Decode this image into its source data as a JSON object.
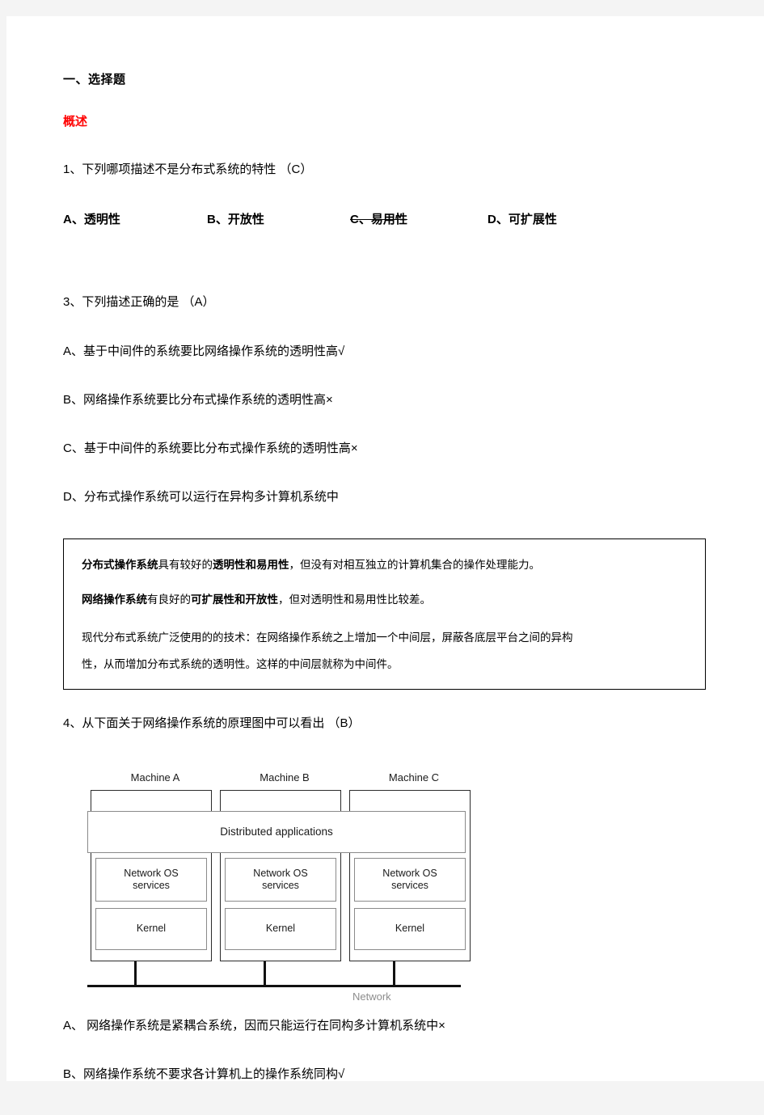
{
  "document": {
    "section_heading": "一、选择题",
    "topic_heading": "概述"
  },
  "questions": [
    {
      "prompt": "1、下列哪项描述不是分布式系统的特性  （C）",
      "options_inline": [
        {
          "label": "A、透明性",
          "struck": false
        },
        {
          "label": "B、开放性",
          "struck": false
        },
        {
          "label": "C、易用性",
          "struck": true
        },
        {
          "label": "D、可扩展性",
          "struck": false
        }
      ]
    },
    {
      "prompt": "3、下列描述正确的是  （A）",
      "options": [
        "A、基于中间件的系统要比网络操作系统的透明性高√",
        "B、网络操作系统要比分布式操作系统的透明性高×",
        "C、基于中间件的系统要比分布式操作系统的透明性高×",
        "D、分布式操作系统可以运行在异构多计算机系统中"
      ]
    },
    {
      "prompt": "4、从下面关于网络操作系统的原理图中可以看出  （B）",
      "options": [
        "A、 网络操作系统是紧耦合系统，因而只能运行在同构多计算机系统中×",
        "B、网络操作系统不要求各计算机上的操作系统同构√"
      ]
    }
  ],
  "note_box": {
    "line1_bold_1": "分布式操作系统",
    "line1_mid_1": "具有较好的",
    "line1_bold_2": "透明性和易用性",
    "line1_tail": "，但没有对相互独立的计算机集合的操作处理能力。",
    "line2_bold_1": "网络操作系统",
    "line2_mid_1": "有良好的",
    "line2_bold_2": "可扩展性和开放性",
    "line2_tail": "，但对透明性和易用性比较差。",
    "line3": "现代分布式系统广泛使用的的技术：在网络操作系统之上增加一个中间层，屏蔽各底层平台之间的异构",
    "line4": "性，从而增加分布式系统的透明性。这样的中间层就称为中间件。"
  },
  "figure": {
    "machines": [
      "Machine A",
      "Machine B",
      "Machine C"
    ],
    "distributed_applications": "Distributed applications",
    "services_label": "Network OS\nservices",
    "services_line1": "Network OS",
    "services_line2": "services",
    "kernel_label": "Kernel",
    "network_label": "Network"
  },
  "colors": {
    "page_background": "#ffffff",
    "canvas_background": "#f4f4f4",
    "topic_heading": "#ff0000",
    "body_text": "#000000",
    "figure_outer_border": "#2b2b2b",
    "figure_inner_border": "#8a8a8a",
    "network_line": "#111111",
    "network_label": "#8d8d8d"
  }
}
